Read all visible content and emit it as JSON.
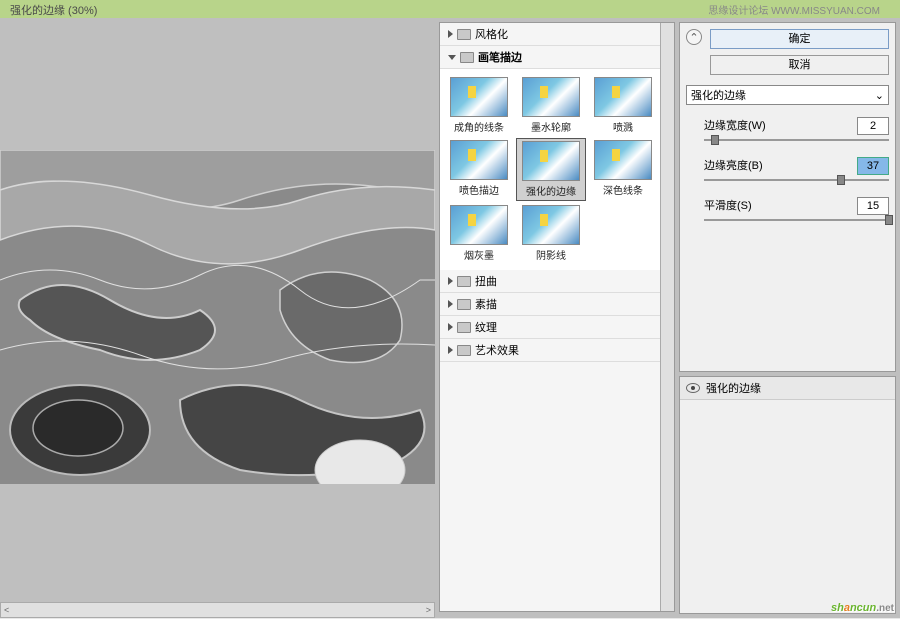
{
  "titlebar": {
    "title": "强化的边缘 (30%)",
    "watermark": "思缘设计论坛  WWW.MISSYUAN.COM"
  },
  "buttons": {
    "ok": "确定",
    "cancel": "取消"
  },
  "dropdown": {
    "selected": "强化的边缘"
  },
  "sliders": [
    {
      "label": "边缘宽度(W)",
      "value": "2",
      "pos": 4
    },
    {
      "label": "边缘亮度(B)",
      "value": "37",
      "pos": 72,
      "hl": true
    },
    {
      "label": "平滑度(S)",
      "value": "15",
      "pos": 98
    }
  ],
  "categories": {
    "stylize": "风格化",
    "brush": "画笔描边",
    "distort": "扭曲",
    "sketch": "素描",
    "texture": "纹理",
    "artistic": "艺术效果"
  },
  "thumbs": [
    {
      "name": "成角的线条"
    },
    {
      "name": "墨水轮廓"
    },
    {
      "name": "喷溅"
    },
    {
      "name": "喷色描边"
    },
    {
      "name": "强化的边缘",
      "sel": true
    },
    {
      "name": "深色线条"
    },
    {
      "name": "烟灰墨"
    },
    {
      "name": "阴影线"
    }
  ],
  "layer": {
    "name": "强化的边缘"
  },
  "logo": {
    "t1": "sh",
    "t2": "a",
    "t3": "ncun",
    "sub": ".net"
  }
}
